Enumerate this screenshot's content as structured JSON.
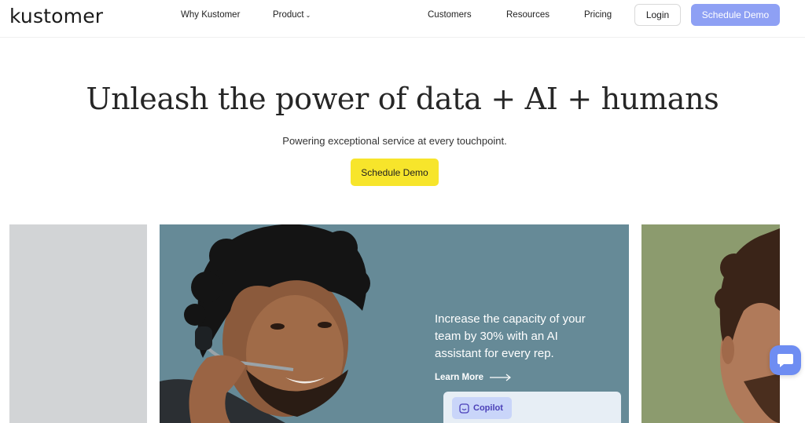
{
  "brand": {
    "logo_text": "kustomer"
  },
  "nav": {
    "items": [
      {
        "label": "Why Kustomer"
      },
      {
        "label": "Product"
      },
      {
        "label": "Customers"
      },
      {
        "label": "Resources"
      },
      {
        "label": "Pricing"
      }
    ],
    "login_label": "Login",
    "demo_label": "Schedule Demo"
  },
  "hero": {
    "title": "Unleash the power of data + AI + humans",
    "subtitle": "Powering exceptional service at every touchpoint.",
    "cta_label": "Schedule Demo"
  },
  "carousel": {
    "main": {
      "promo_text": "Increase the capacity of your team by 30% with an AI assistant for every rep.",
      "learn_more_label": "Learn More",
      "copilot_label": "Copilot"
    }
  },
  "colors": {
    "accent": "#8ea0f4",
    "cta_yellow": "#f7e52b",
    "panel_main": "#668a97",
    "panel_right": "#8c9b6e",
    "chat": "#6e8df2"
  },
  "icons": [
    "chevron-down-icon",
    "arrow-right-icon",
    "copilot-icon",
    "chat-icon"
  ]
}
